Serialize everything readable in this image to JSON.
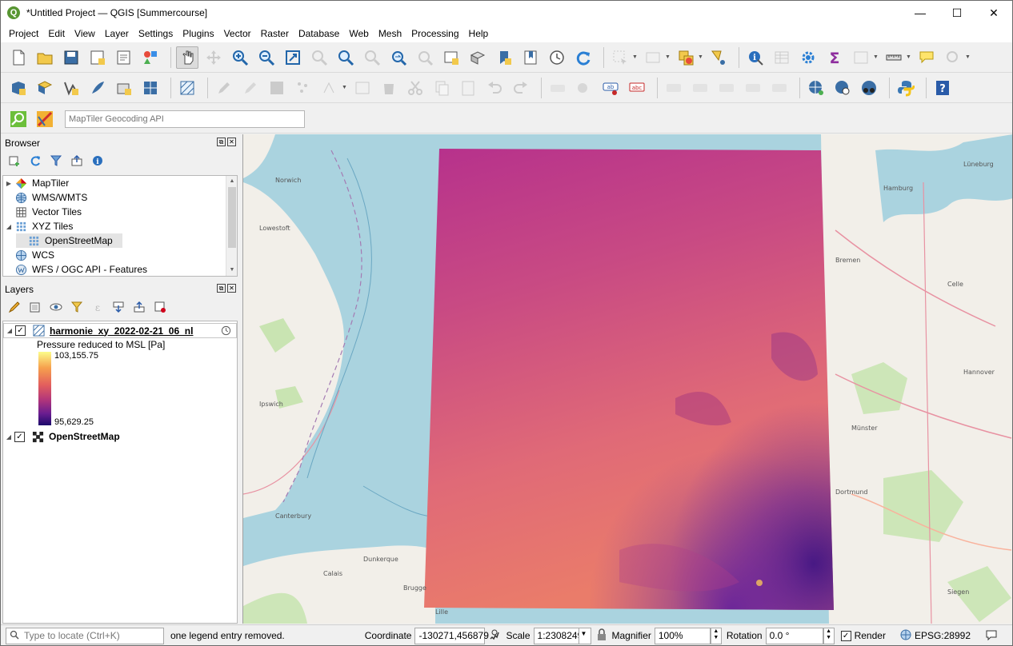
{
  "window": {
    "title": "*Untitled Project — QGIS [Summercourse]",
    "app_icon": "Q",
    "controls": {
      "minimize": "—",
      "maximize": "☐",
      "close": "✕"
    }
  },
  "menu": [
    "Project",
    "Edit",
    "View",
    "Layer",
    "Settings",
    "Plugins",
    "Vector",
    "Raster",
    "Database",
    "Web",
    "Mesh",
    "Processing",
    "Help"
  ],
  "geocoding": {
    "placeholder": "MapTiler Geocoding API"
  },
  "browser": {
    "title": "Browser",
    "items": [
      {
        "label": "MapTiler",
        "icon": "maptiler-icon",
        "expanded": false
      },
      {
        "label": "WMS/WMTS",
        "icon": "globe-icon"
      },
      {
        "label": "Vector Tiles",
        "icon": "grid-icon"
      },
      {
        "label": "XYZ Tiles",
        "icon": "grid-icon",
        "expanded": true
      },
      {
        "label": "OpenStreetMap",
        "icon": "grid-icon",
        "child": true,
        "selected": true
      },
      {
        "label": "WCS",
        "icon": "globe-icon"
      },
      {
        "label": "WFS / OGC API - Features",
        "icon": "globe-icon"
      }
    ]
  },
  "layers": {
    "title": "Layers",
    "items": [
      {
        "label": "harmonie_xy_2022-02-21_06_nl",
        "checked": true
      },
      {
        "label": "OpenStreetMap",
        "checked": true
      }
    ],
    "legend": {
      "title": "Pressure reduced to MSL [Pa]",
      "max": "103,155.75",
      "min": "95,629.25"
    }
  },
  "map": {
    "labels": [
      "Norwich",
      "Lowestoft",
      "Calais",
      "Dunkerque",
      "Münster",
      "Hamburg",
      "Bremen",
      "Hannover",
      "Dortmund",
      "Brugge",
      "Ipswich",
      "Canterbury",
      "Lille",
      "Siegen",
      "Lüneburg",
      "Celle"
    ]
  },
  "status": {
    "locate_placeholder": "Type to locate (Ctrl+K)",
    "message": "one legend entry removed.",
    "coordinate_label": "Coordinate",
    "coordinate": "-130271,456879",
    "scale_label": "Scale",
    "scale": "1:2308249",
    "magnifier_label": "Magnifier",
    "magnifier": "100%",
    "rotation_label": "Rotation",
    "rotation": "0.0 °",
    "render_label": "Render",
    "crs": "EPSG:28992"
  }
}
